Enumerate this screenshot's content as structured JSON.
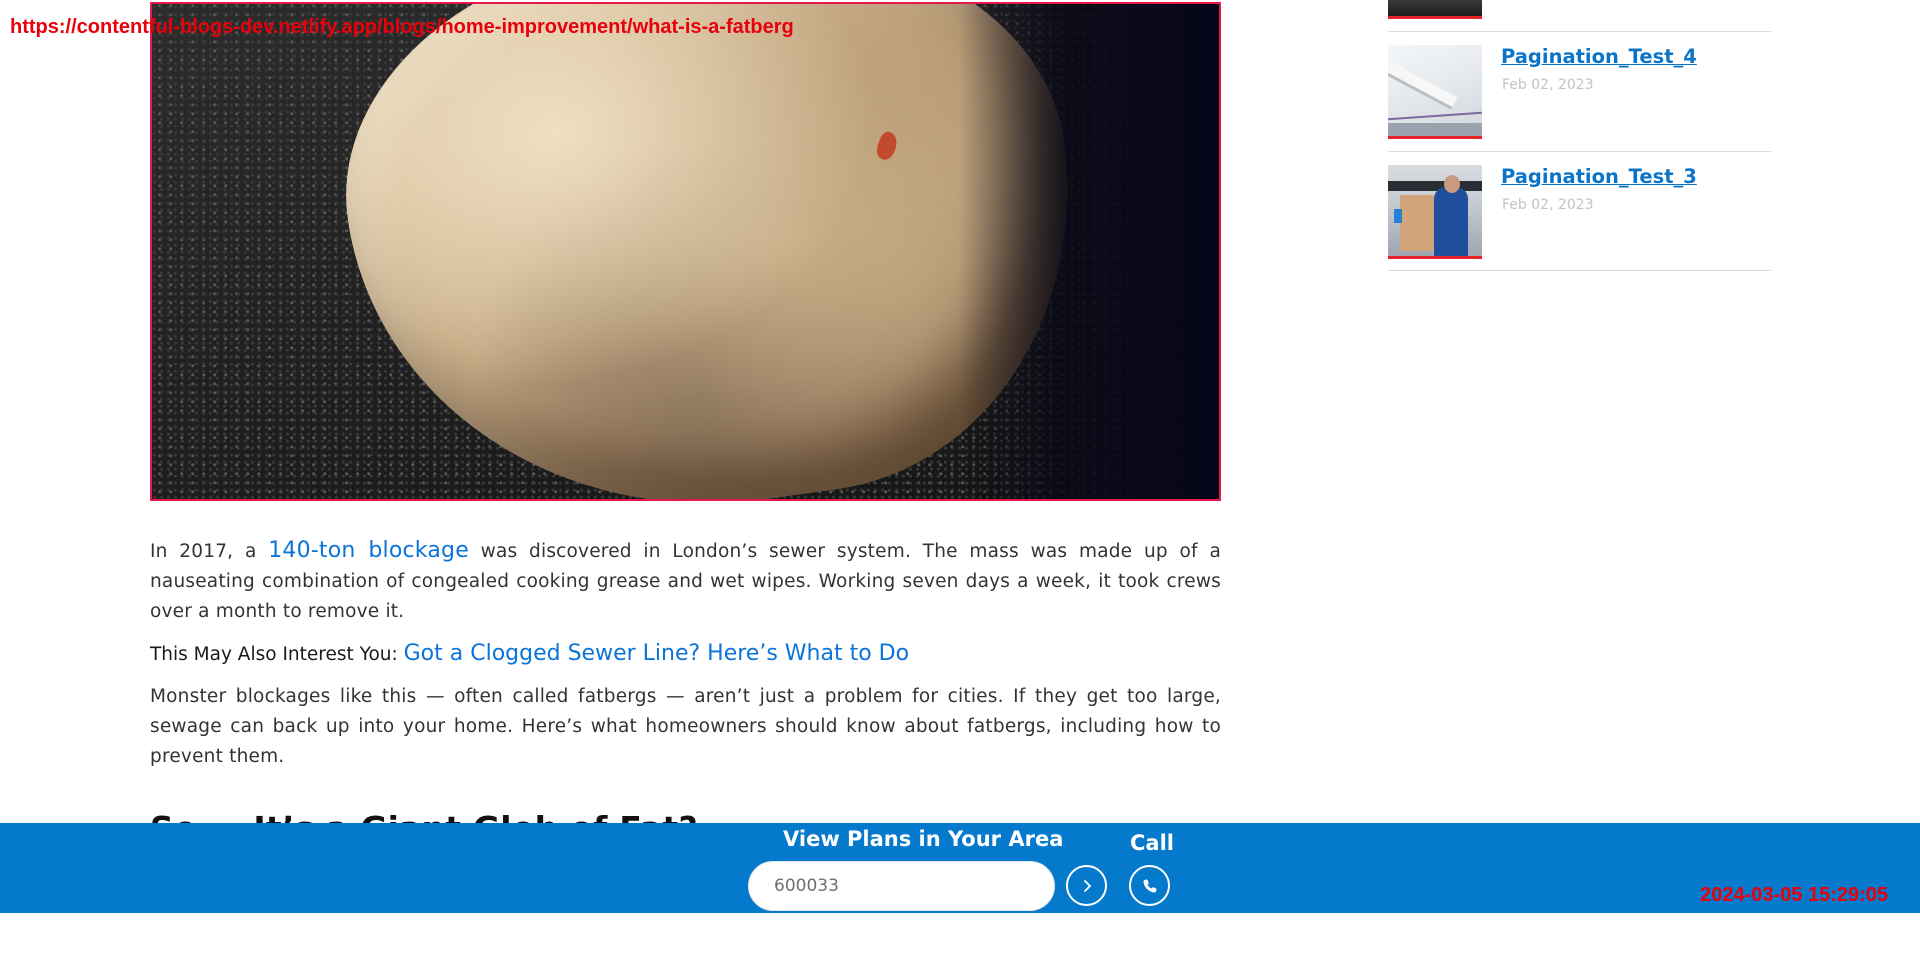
{
  "overlay": {
    "url": "https://contentful-blogs-dev.netlify.app/blogs/home-improvement/what-is-a-fatberg",
    "timestamp": "2024-03-05 15:29:05"
  },
  "article": {
    "paragraph1": {
      "before_link": "In 2017, a ",
      "link_text": "140-ton blockage",
      "after_link": " was discovered in London’s sewer system. The mass was made up of a nauseating combination of congealed cooking grease and wet wipes. Working seven days a week, it took crews over a month to remove it."
    },
    "interest": {
      "label": "This May Also Interest You: ",
      "link_text": "Got a Clogged Sewer Line? Here’s What to Do"
    },
    "paragraph2": "Monster blockages like this — often called fatbergs — aren’t just a problem for cities. If they get too large, sewage can back up into your home. Here’s what homeowners should know about fatbergs, including how to prevent them.",
    "subheading": "So … It’s a Giant Glob of Fat?"
  },
  "sidebar": {
    "items": [
      {
        "title": "Pagination_Test_4",
        "date": "Feb 02, 2023"
      },
      {
        "title": "Pagination_Test_3",
        "date": "Feb 02, 2023"
      }
    ]
  },
  "cta": {
    "view_plans_label": "View Plans in Your Area",
    "zip_value": "600033",
    "call_label": "Call",
    "go_icon": "chevron-right-icon",
    "phone_icon": "phone-icon",
    "bar_color": "#0579cb",
    "link_color": "#0a74d9",
    "accent_red": "#e8232a"
  }
}
